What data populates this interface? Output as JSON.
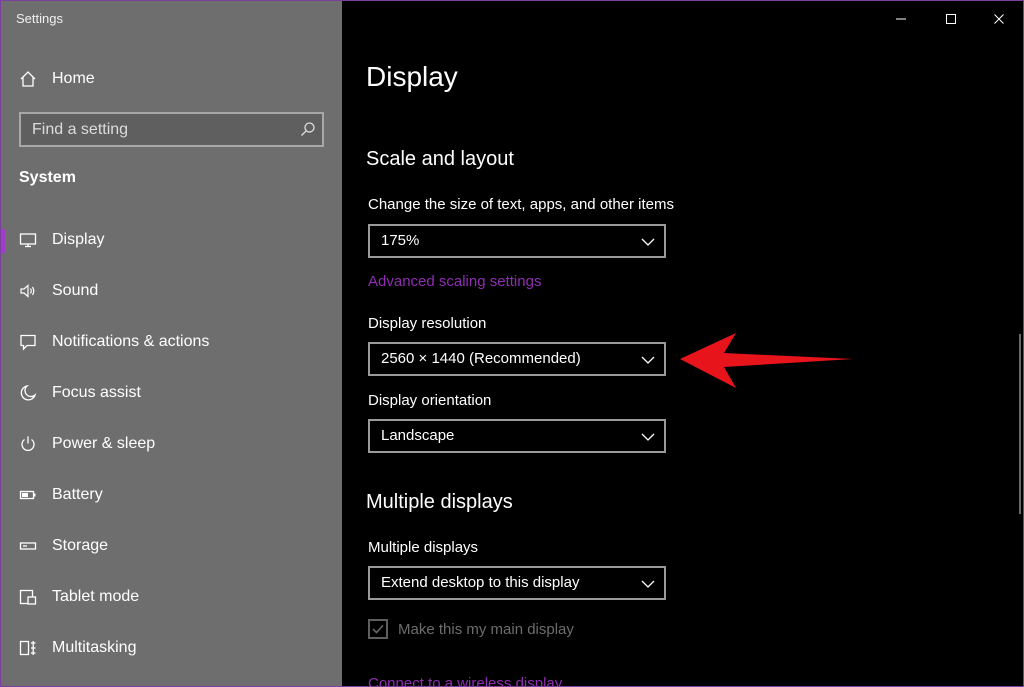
{
  "window": {
    "app_title": "Settings"
  },
  "sidebar": {
    "home_label": "Home",
    "search_placeholder": "Find a setting",
    "section_title": "System",
    "items": [
      {
        "label": "Display",
        "icon": "monitor-icon",
        "active": true
      },
      {
        "label": "Sound",
        "icon": "speaker-icon"
      },
      {
        "label": "Notifications & actions",
        "icon": "message-icon"
      },
      {
        "label": "Focus assist",
        "icon": "moon-icon"
      },
      {
        "label": "Power & sleep",
        "icon": "power-icon"
      },
      {
        "label": "Battery",
        "icon": "battery-icon"
      },
      {
        "label": "Storage",
        "icon": "storage-icon"
      },
      {
        "label": "Tablet mode",
        "icon": "tablet-icon"
      },
      {
        "label": "Multitasking",
        "icon": "multitasking-icon"
      }
    ]
  },
  "main": {
    "page_title": "Display",
    "scale_section": {
      "heading": "Scale and layout",
      "size_label": "Change the size of text, apps, and other items",
      "size_value": "175%",
      "advanced_link": "Advanced scaling settings",
      "resolution_label": "Display resolution",
      "resolution_value": "2560 × 1440 (Recommended)",
      "orientation_label": "Display orientation",
      "orientation_value": "Landscape"
    },
    "multiple_section": {
      "heading": "Multiple displays",
      "multiple_label": "Multiple displays",
      "multiple_value": "Extend desktop to this display",
      "main_display_label": "Make this my main display",
      "main_display_checked": true,
      "wireless_link": "Connect to a wireless display"
    }
  },
  "colors": {
    "accent": "#8f2db3",
    "annotation_arrow": "#e8141c"
  }
}
